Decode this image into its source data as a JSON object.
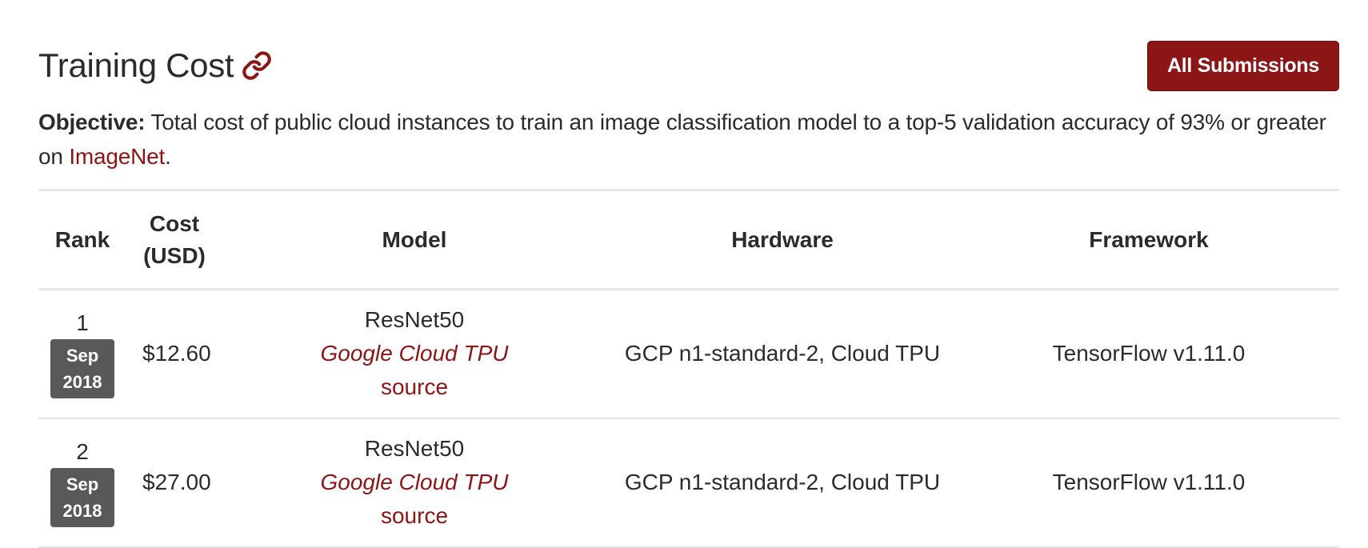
{
  "section": {
    "title": "Training Cost",
    "link_icon": "link-icon",
    "all_submissions_label": "All Submissions"
  },
  "objective": {
    "label": "Objective:",
    "text_before": " Total cost of public cloud instances to train an image classification model to a top-5 validation accuracy of 93% or greater on ",
    "link_text": "ImageNet",
    "text_after": "."
  },
  "table": {
    "headers": {
      "rank": "Rank",
      "cost_line1": "Cost",
      "cost_line2": "(USD)",
      "model": "Model",
      "hardware": "Hardware",
      "framework": "Framework"
    },
    "rows": [
      {
        "rank": "1",
        "date_month": "Sep",
        "date_year": "2018",
        "cost": "$12.60",
        "model": "ResNet50",
        "model_org": "Google Cloud TPU",
        "source": "source",
        "hardware": "GCP n1-standard-2, Cloud TPU",
        "framework": "TensorFlow v1.11.0"
      },
      {
        "rank": "2",
        "date_month": "Sep",
        "date_year": "2018",
        "cost": "$27.00",
        "model": "ResNet50",
        "model_org": "Google Cloud TPU",
        "source": "source",
        "hardware": "GCP n1-standard-2, Cloud TPU",
        "framework": "TensorFlow v1.11.0"
      }
    ]
  },
  "colors": {
    "accent": "#8c1515",
    "badge": "#595959",
    "text": "#2b2b2b",
    "rule": "#e8e8e8"
  }
}
